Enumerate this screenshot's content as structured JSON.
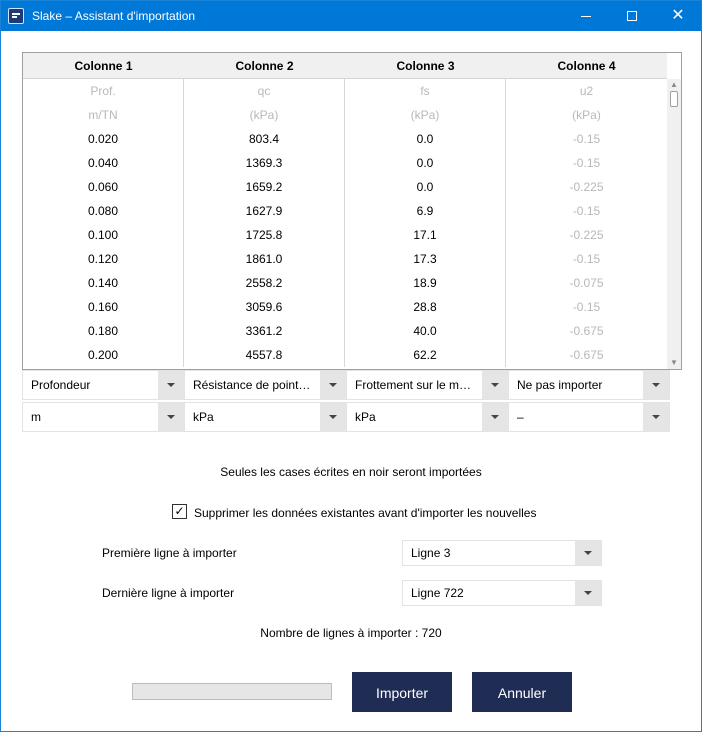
{
  "window": {
    "title": "Slake – Assistant d'importation",
    "close_glyph": "✕"
  },
  "table": {
    "headers": [
      "Colonne 1",
      "Colonne 2",
      "Colonne 3",
      "Colonne 4"
    ],
    "rows": [
      [
        "Prof.",
        "qc",
        "fs",
        "u2"
      ],
      [
        "m/TN",
        "(kPa)",
        "(kPa)",
        "(kPa)"
      ],
      [
        "0.020",
        "803.4",
        "0.0",
        "-0.15"
      ],
      [
        "0.040",
        "1369.3",
        "0.0",
        "-0.15"
      ],
      [
        "0.060",
        "1659.2",
        "0.0",
        "-0.225"
      ],
      [
        "0.080",
        "1627.9",
        "6.9",
        "-0.15"
      ],
      [
        "0.100",
        "1725.8",
        "17.1",
        "-0.225"
      ],
      [
        "0.120",
        "1861.0",
        "17.3",
        "-0.15"
      ],
      [
        "0.140",
        "2558.2",
        "18.9",
        "-0.075"
      ],
      [
        "0.160",
        "3059.6",
        "28.8",
        "-0.15"
      ],
      [
        "0.180",
        "3361.2",
        "40.0",
        "-0.675"
      ],
      [
        "0.200",
        "4557.8",
        "62.2",
        "-0.675"
      ]
    ]
  },
  "column_types": [
    "Profondeur",
    "Résistance de point…",
    "Frottement sur le m…",
    "Ne pas importer"
  ],
  "column_units": [
    "m",
    "kPa",
    "kPa",
    "–"
  ],
  "info_text": "Seules les cases écrites en noir seront importées",
  "clear_option": {
    "label": "Supprimer les données existantes avant d'importer les nouvelles",
    "checked": true,
    "check_glyph": "✓"
  },
  "first_line": {
    "label": "Première ligne à importer",
    "value": "Ligne 3"
  },
  "last_line": {
    "label": "Dernière ligne à importer",
    "value": "Ligne 722"
  },
  "count_text": "Nombre de lignes à importer : 720",
  "progress_fraction": 0,
  "buttons": {
    "import": "Importer",
    "cancel": "Annuler"
  }
}
